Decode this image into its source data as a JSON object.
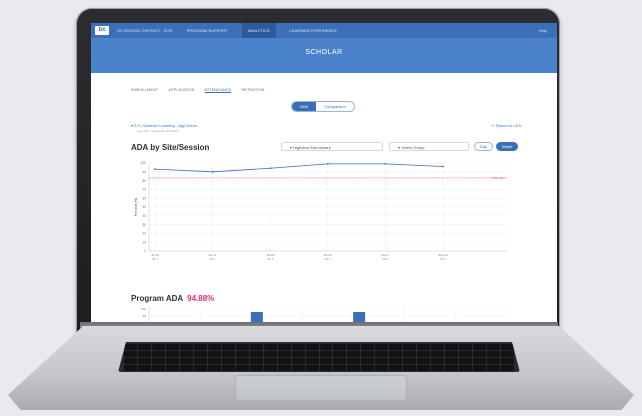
{
  "topbar": {
    "logo": "bx",
    "nav": [
      {
        "label": "SO SCHOOL DISTRICT - SITE"
      },
      {
        "label": "PROGRAM SUPPORT"
      },
      {
        "label": "ANALYTICS"
      },
      {
        "label": "LEARNING EXPERIENCE"
      }
    ],
    "active_index": 2,
    "right_label": "Help"
  },
  "banner": {
    "title": "SCHOLAR"
  },
  "tabs": [
    "ENROLLMENT",
    "APPLICATION",
    "ATTENDANCE",
    "RETENTION"
  ],
  "active_tab": 2,
  "pills": [
    "ADA",
    "Comparison"
  ],
  "program": {
    "name": "2.0 | Summer Learning - App Demo",
    "subtitle": "June 5th - September 4th 2023",
    "return_label": "Return to LEA"
  },
  "chart_title": "ADA by Site/Session",
  "filters": {
    "site": "Highview Elementary",
    "group": "Select Group"
  },
  "toggle": [
    "Day",
    "Week"
  ],
  "colors": {
    "primary": "#3b6fb8",
    "banner": "#4a83cc",
    "line": "#3b6fb8",
    "target": "#e05a6a",
    "accent_pink": "#d6337a"
  },
  "chart_data": {
    "type": "line",
    "ylabel": "Percent (%)",
    "ylim": [
      0,
      100
    ],
    "y_ticks": [
      "100",
      "90",
      "80",
      "70",
      "60",
      "50",
      "40",
      "30",
      "20",
      "10",
      "0"
    ],
    "x": [
      "Jul 10",
      "Jul 17",
      "Jul 24",
      "Jul 31",
      "Aug 7",
      "Aug 14"
    ],
    "x_sub": [
      "Wk 1",
      "Wk 2",
      "Wk 3",
      "Wk 4",
      "Wk 5",
      "Wk 6"
    ],
    "series": [
      {
        "name": "",
        "values": [
          93,
          90,
          94,
          99,
          99,
          96
        ]
      }
    ],
    "target": {
      "value": 83,
      "label": "80% ADA"
    }
  },
  "program_ada": {
    "label": "Program ADA",
    "value": "94.88%",
    "y_ticks": [
      "100",
      "80"
    ],
    "bar_positions": [
      2,
      4
    ]
  }
}
